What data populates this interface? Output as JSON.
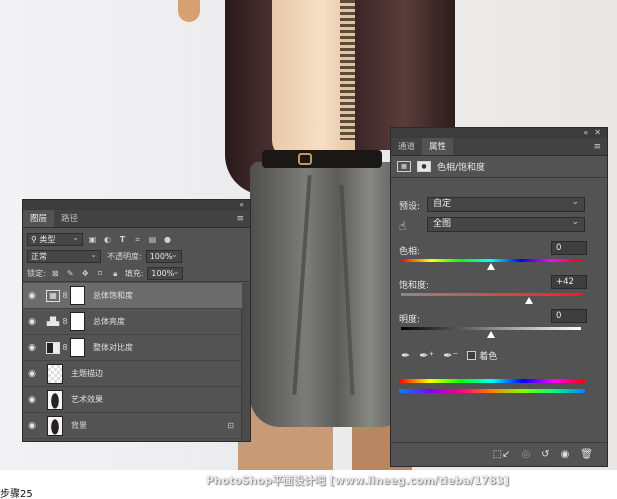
{
  "layers_panel": {
    "tabs": [
      "图层",
      "路径"
    ],
    "filter_kind": "类型",
    "blend_mode": "正常",
    "opacity_label": "不透明度:",
    "opacity_value": "100%",
    "lock_label": "锁定:",
    "fill_label": "填充:",
    "fill_value": "100%",
    "layers": [
      {
        "name": "总体饱和度",
        "type": "adjustment",
        "icon": "hue-saturation-icon",
        "selected": true
      },
      {
        "name": "总体亮度",
        "type": "adjustment",
        "icon": "levels-icon",
        "selected": false
      },
      {
        "name": "整体对比度",
        "type": "adjustment",
        "icon": "brightness-contrast-icon",
        "selected": false
      },
      {
        "name": "主题描边",
        "type": "pixel",
        "thumb": "transparent",
        "selected": false
      },
      {
        "name": "艺术效果",
        "type": "pixel",
        "thumb": "figure",
        "selected": false
      },
      {
        "name": "背景",
        "type": "pixel",
        "thumb": "figure",
        "selected": false,
        "locked": true
      }
    ]
  },
  "properties_panel": {
    "tabs": [
      "通道",
      "属性"
    ],
    "title": "色相/饱和度",
    "preset_label": "预设:",
    "preset_value": "自定",
    "channel_value": "全图",
    "hue_label": "色相:",
    "hue_value": "0",
    "saturation_label": "饱和度:",
    "saturation_value": "+42",
    "lightness_label": "明度:",
    "lightness_value": "0",
    "colorize_label": "着色",
    "hue_knob_fraction": 0.5,
    "saturation_knob_fraction": 0.71,
    "lightness_knob_fraction": 0.5
  },
  "watermark": "PhotoShop平面设计吧 [www.lineeg.com/tieba/1783]",
  "caption": "步骤25",
  "colors": {
    "panel_bg": "#535353",
    "panel_dark": "#424242",
    "selected_layer": "#6b6b6b"
  }
}
